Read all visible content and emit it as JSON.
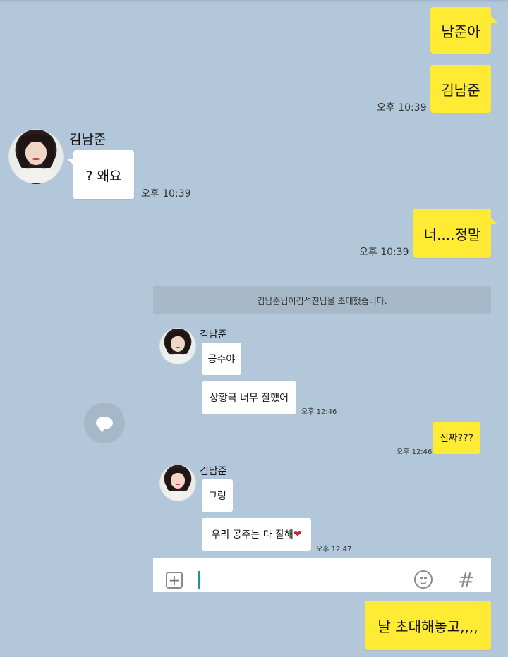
{
  "chat": {
    "msg1": "남준아",
    "msg2": "김남준",
    "time1": "오후 10:39",
    "sender1": "김남준",
    "reply1": "? 왜요",
    "time2": "오후 10:39",
    "msg3": "너....정말",
    "time3": "오후 10:39",
    "msg4": "날 초대해놓고,,,,"
  },
  "embedded": {
    "banner_prefix": "김남준님이 ",
    "banner_name": "김석진님",
    "banner_suffix": "을 초대했습니다.",
    "sender_a": "김남준",
    "bubble_a1": "공주야",
    "bubble_a2": "상황극 너무 잘했어",
    "time_a": "오후 12:46",
    "bubble_me": "진짜???",
    "time_me": "오후 12:46",
    "sender_b": "김남준",
    "bubble_b1": "그렁",
    "bubble_b2_text": "우리 공주는 다 잘해",
    "bubble_b2_heart": "❤",
    "time_b": "오후 12:47"
  },
  "icons": {
    "plus": "plus-icon",
    "emoji": "emoticon-icon",
    "hash": "#",
    "share": "share-chat-icon"
  },
  "colors": {
    "background": "#b2c7da",
    "my_bubble": "#ffeb33",
    "their_bubble": "#ffffff",
    "cursor": "#1a9a84",
    "heart": "#d4202c"
  }
}
